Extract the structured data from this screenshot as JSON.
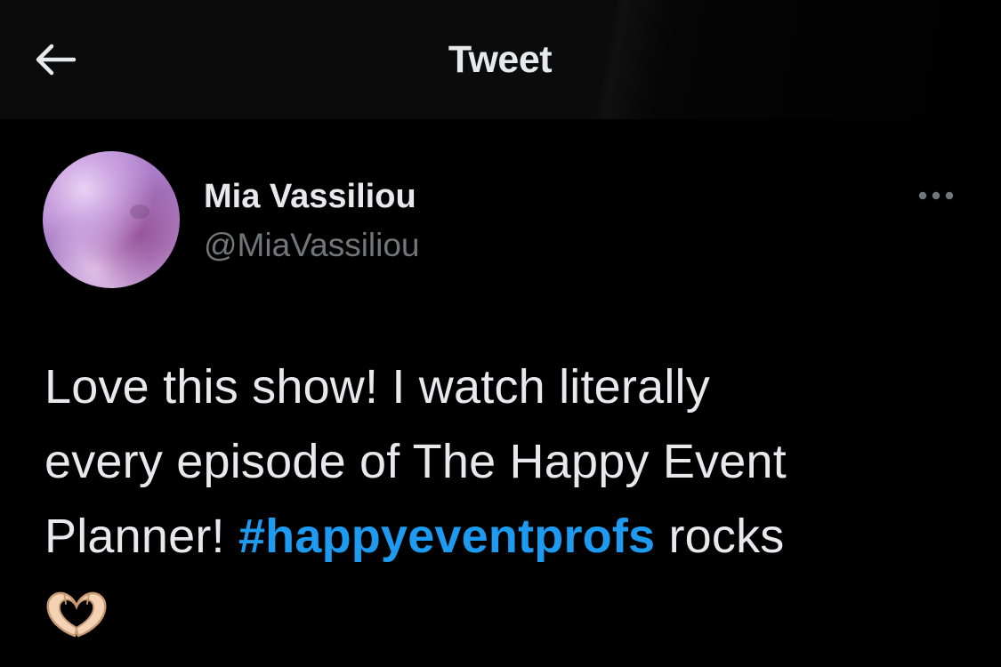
{
  "header": {
    "title": "Tweet",
    "back_icon": "arrow-left-icon"
  },
  "tweet": {
    "author": {
      "display_name": "Mia Vassiliou",
      "handle": "@MiaVassiliou",
      "avatar_icon": "avatar-image"
    },
    "more_icon": "more-horizontal-icon",
    "text": {
      "line1": "Love this show! I watch literally",
      "line2": "every episode of The Happy Event",
      "line3_before": "Planner! ",
      "hashtag": "#happyeventprofs",
      "line3_after": " rocks",
      "emoji_icon": "heart-hands-icon"
    }
  },
  "colors": {
    "background": "#000000",
    "header_background": "#0b0b0b",
    "text_primary": "#e7e9ea",
    "text_secondary": "#71767b",
    "link": "#1d9bf0"
  }
}
